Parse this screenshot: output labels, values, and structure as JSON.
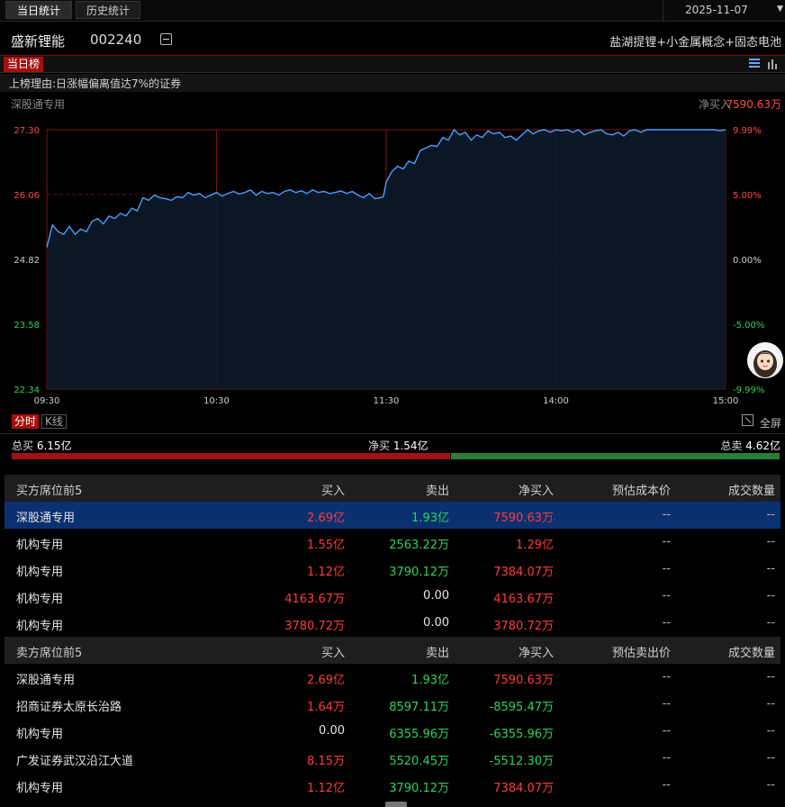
{
  "tabs": {
    "today": "当日统计",
    "history": "历史统计"
  },
  "date": "2025-11-07",
  "stock": {
    "name": "盛新锂能",
    "code": "002240",
    "concepts": "盐湖提锂+小金属概念+固态电池"
  },
  "rank_tag": "当日榜",
  "reason": "上榜理由:日涨幅偏离值达7%的证券",
  "seat_label": "深股通专用",
  "net_buy": {
    "label": "净买入",
    "value": "7590.63万"
  },
  "chart_data": {
    "type": "line",
    "price_ticks": [
      "27.30",
      "26.06",
      "24.82",
      "23.58",
      "22.34"
    ],
    "pct_ticks": [
      "9.99%",
      "5.00%",
      "0.00%",
      "-5.00%",
      "-9.99%"
    ],
    "time_ticks": [
      "09:30",
      "10:30",
      "11:30",
      "14:00",
      "15:00"
    ],
    "ylim": [
      22.34,
      27.3
    ],
    "prev_close": 24.82,
    "series": [
      {
        "x": [
          0,
          2,
          4,
          6,
          8,
          10,
          12,
          14,
          16,
          18,
          20,
          22,
          24,
          26,
          28,
          30,
          32,
          34,
          36,
          38,
          40,
          42,
          44,
          46,
          48,
          50,
          52,
          54,
          56,
          58,
          60,
          62,
          64,
          66,
          68,
          70,
          72,
          74,
          76,
          78,
          80,
          82,
          84,
          86,
          88,
          90,
          92,
          94,
          96,
          98,
          100,
          102,
          104,
          106,
          108,
          110,
          112,
          114,
          116,
          118,
          119,
          120,
          122,
          124,
          126,
          128,
          130,
          132,
          134,
          136,
          138,
          140,
          142,
          144,
          146,
          148,
          150,
          152,
          154,
          156,
          158,
          160,
          162,
          164,
          166,
          168,
          170,
          172,
          174,
          176,
          178,
          180,
          182,
          184,
          186,
          188,
          190,
          192,
          194,
          196,
          198,
          200,
          202,
          204,
          206,
          208,
          210,
          212,
          214,
          216,
          218,
          220,
          222,
          224,
          226,
          228,
          230,
          232,
          234,
          236,
          238,
          240
        ],
        "values": [
          25.05,
          25.48,
          25.35,
          25.3,
          25.45,
          25.3,
          25.4,
          25.35,
          25.55,
          25.6,
          25.5,
          25.65,
          25.6,
          25.7,
          25.65,
          25.8,
          25.75,
          26.0,
          25.95,
          26.05,
          26.0,
          25.98,
          25.95,
          26.02,
          26.0,
          26.1,
          26.05,
          26.08,
          26.0,
          26.05,
          26.1,
          26.03,
          26.08,
          26.12,
          26.07,
          26.1,
          26.15,
          26.05,
          26.12,
          26.08,
          26.1,
          26.05,
          26.12,
          26.15,
          26.1,
          26.13,
          26.08,
          26.15,
          26.1,
          26.12,
          26.08,
          26.1,
          26.13,
          26.08,
          26.12,
          26.05,
          26.0,
          26.08,
          25.98,
          26.0,
          26.02,
          26.3,
          26.5,
          26.6,
          26.55,
          26.7,
          26.65,
          26.9,
          26.95,
          27.0,
          26.98,
          27.15,
          27.1,
          27.3,
          27.2,
          27.25,
          27.1,
          27.2,
          27.15,
          27.28,
          27.22,
          27.25,
          27.15,
          27.18,
          27.1,
          27.2,
          27.3,
          27.22,
          27.28,
          27.3,
          27.25,
          27.3,
          27.28,
          27.3,
          27.25,
          27.3,
          27.2,
          27.25,
          27.28,
          27.3,
          27.22,
          27.2,
          27.25,
          27.18,
          27.28,
          27.3,
          27.25,
          27.3,
          27.3,
          27.3,
          27.3,
          27.3,
          27.3,
          27.3,
          27.3,
          27.3,
          27.3,
          27.3,
          27.3,
          27.3,
          27.28,
          27.3
        ]
      }
    ]
  },
  "modes": {
    "fen": "分时",
    "k": "K线"
  },
  "fullscreen": "全屏",
  "summary": {
    "total_buy_label": "总买",
    "total_buy": "6.15亿",
    "net_buy_label": "净买",
    "net_buy": "1.54亿",
    "total_sell_label": "总卖",
    "total_sell": "4.62亿",
    "buy_ratio": 0.571
  },
  "buy_table": {
    "headers": [
      "买方席位前5",
      "买入",
      "卖出",
      "净买入",
      "预估成本价",
      "成交数量"
    ],
    "rows": [
      [
        "深股通专用",
        "2.69亿",
        "1.93亿",
        "7590.63万",
        "--",
        "--"
      ],
      [
        "机构专用",
        "1.55亿",
        "2563.22万",
        "1.29亿",
        "--",
        "--"
      ],
      [
        "机构专用",
        "1.12亿",
        "3790.12万",
        "7384.07万",
        "--",
        "--"
      ],
      [
        "机构专用",
        "4163.67万",
        "0.00",
        "4163.67万",
        "--",
        "--"
      ],
      [
        "机构专用",
        "3780.72万",
        "0.00",
        "3780.72万",
        "--",
        "--"
      ]
    ]
  },
  "sell_table": {
    "headers": [
      "卖方席位前5",
      "买入",
      "卖出",
      "净买入",
      "预估卖出价",
      "成交数量"
    ],
    "rows": [
      [
        "深股通专用",
        "2.69亿",
        "1.93亿",
        "7590.63万",
        "--",
        "--"
      ],
      [
        "招商证券太原长治路",
        "1.64万",
        "8597.11万",
        "-8595.47万",
        "--",
        "--"
      ],
      [
        "机构专用",
        "0.00",
        "6355.96万",
        "-6355.96万",
        "--",
        "--"
      ],
      [
        "广发证券武汉沿江大道",
        "8.15万",
        "5520.45万",
        "-5512.30万",
        "--",
        "--"
      ],
      [
        "机构专用",
        "1.12亿",
        "3790.12万",
        "7384.07万",
        "--",
        "--"
      ]
    ]
  },
  "colors": {
    "up": "#ff3b3b",
    "down": "#2fd35a",
    "line": "#4a9fff",
    "selected": "#0b3070"
  }
}
